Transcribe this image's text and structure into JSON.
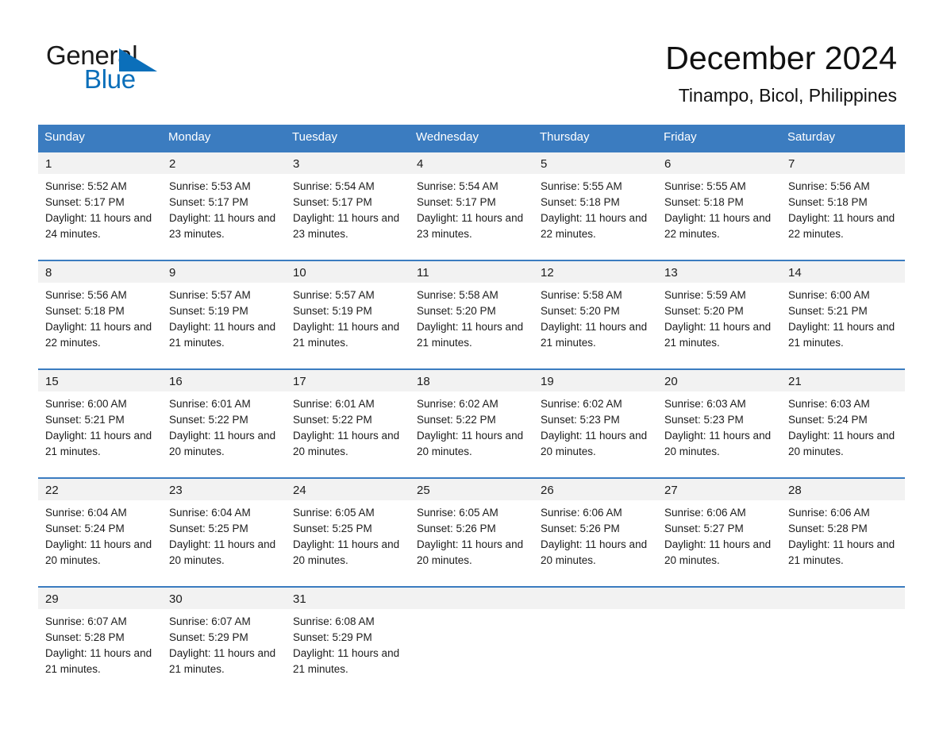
{
  "brand": {
    "name_line1": "General",
    "name_line2": "Blue",
    "triangle_icon": "triangle-logo-icon",
    "accent_color": "#0b6fba"
  },
  "header": {
    "month_title": "December 2024",
    "location": "Tinampo, Bicol, Philippines"
  },
  "colors": {
    "header_blue": "#3b7cc0",
    "daynum_band": "#f2f2f2",
    "text": "#1c1c1c"
  },
  "calendar": {
    "weekdays": [
      "Sunday",
      "Monday",
      "Tuesday",
      "Wednesday",
      "Thursday",
      "Friday",
      "Saturday"
    ],
    "weeks": [
      [
        {
          "day": "1",
          "sunrise": "Sunrise: 5:52 AM",
          "sunset": "Sunset: 5:17 PM",
          "daylight": "Daylight: 11 hours and 24 minutes."
        },
        {
          "day": "2",
          "sunrise": "Sunrise: 5:53 AM",
          "sunset": "Sunset: 5:17 PM",
          "daylight": "Daylight: 11 hours and 23 minutes."
        },
        {
          "day": "3",
          "sunrise": "Sunrise: 5:54 AM",
          "sunset": "Sunset: 5:17 PM",
          "daylight": "Daylight: 11 hours and 23 minutes."
        },
        {
          "day": "4",
          "sunrise": "Sunrise: 5:54 AM",
          "sunset": "Sunset: 5:17 PM",
          "daylight": "Daylight: 11 hours and 23 minutes."
        },
        {
          "day": "5",
          "sunrise": "Sunrise: 5:55 AM",
          "sunset": "Sunset: 5:18 PM",
          "daylight": "Daylight: 11 hours and 22 minutes."
        },
        {
          "day": "6",
          "sunrise": "Sunrise: 5:55 AM",
          "sunset": "Sunset: 5:18 PM",
          "daylight": "Daylight: 11 hours and 22 minutes."
        },
        {
          "day": "7",
          "sunrise": "Sunrise: 5:56 AM",
          "sunset": "Sunset: 5:18 PM",
          "daylight": "Daylight: 11 hours and 22 minutes."
        }
      ],
      [
        {
          "day": "8",
          "sunrise": "Sunrise: 5:56 AM",
          "sunset": "Sunset: 5:18 PM",
          "daylight": "Daylight: 11 hours and 22 minutes."
        },
        {
          "day": "9",
          "sunrise": "Sunrise: 5:57 AM",
          "sunset": "Sunset: 5:19 PM",
          "daylight": "Daylight: 11 hours and 21 minutes."
        },
        {
          "day": "10",
          "sunrise": "Sunrise: 5:57 AM",
          "sunset": "Sunset: 5:19 PM",
          "daylight": "Daylight: 11 hours and 21 minutes."
        },
        {
          "day": "11",
          "sunrise": "Sunrise: 5:58 AM",
          "sunset": "Sunset: 5:20 PM",
          "daylight": "Daylight: 11 hours and 21 minutes."
        },
        {
          "day": "12",
          "sunrise": "Sunrise: 5:58 AM",
          "sunset": "Sunset: 5:20 PM",
          "daylight": "Daylight: 11 hours and 21 minutes."
        },
        {
          "day": "13",
          "sunrise": "Sunrise: 5:59 AM",
          "sunset": "Sunset: 5:20 PM",
          "daylight": "Daylight: 11 hours and 21 minutes."
        },
        {
          "day": "14",
          "sunrise": "Sunrise: 6:00 AM",
          "sunset": "Sunset: 5:21 PM",
          "daylight": "Daylight: 11 hours and 21 minutes."
        }
      ],
      [
        {
          "day": "15",
          "sunrise": "Sunrise: 6:00 AM",
          "sunset": "Sunset: 5:21 PM",
          "daylight": "Daylight: 11 hours and 21 minutes."
        },
        {
          "day": "16",
          "sunrise": "Sunrise: 6:01 AM",
          "sunset": "Sunset: 5:22 PM",
          "daylight": "Daylight: 11 hours and 20 minutes."
        },
        {
          "day": "17",
          "sunrise": "Sunrise: 6:01 AM",
          "sunset": "Sunset: 5:22 PM",
          "daylight": "Daylight: 11 hours and 20 minutes."
        },
        {
          "day": "18",
          "sunrise": "Sunrise: 6:02 AM",
          "sunset": "Sunset: 5:22 PM",
          "daylight": "Daylight: 11 hours and 20 minutes."
        },
        {
          "day": "19",
          "sunrise": "Sunrise: 6:02 AM",
          "sunset": "Sunset: 5:23 PM",
          "daylight": "Daylight: 11 hours and 20 minutes."
        },
        {
          "day": "20",
          "sunrise": "Sunrise: 6:03 AM",
          "sunset": "Sunset: 5:23 PM",
          "daylight": "Daylight: 11 hours and 20 minutes."
        },
        {
          "day": "21",
          "sunrise": "Sunrise: 6:03 AM",
          "sunset": "Sunset: 5:24 PM",
          "daylight": "Daylight: 11 hours and 20 minutes."
        }
      ],
      [
        {
          "day": "22",
          "sunrise": "Sunrise: 6:04 AM",
          "sunset": "Sunset: 5:24 PM",
          "daylight": "Daylight: 11 hours and 20 minutes."
        },
        {
          "day": "23",
          "sunrise": "Sunrise: 6:04 AM",
          "sunset": "Sunset: 5:25 PM",
          "daylight": "Daylight: 11 hours and 20 minutes."
        },
        {
          "day": "24",
          "sunrise": "Sunrise: 6:05 AM",
          "sunset": "Sunset: 5:25 PM",
          "daylight": "Daylight: 11 hours and 20 minutes."
        },
        {
          "day": "25",
          "sunrise": "Sunrise: 6:05 AM",
          "sunset": "Sunset: 5:26 PM",
          "daylight": "Daylight: 11 hours and 20 minutes."
        },
        {
          "day": "26",
          "sunrise": "Sunrise: 6:06 AM",
          "sunset": "Sunset: 5:26 PM",
          "daylight": "Daylight: 11 hours and 20 minutes."
        },
        {
          "day": "27",
          "sunrise": "Sunrise: 6:06 AM",
          "sunset": "Sunset: 5:27 PM",
          "daylight": "Daylight: 11 hours and 20 minutes."
        },
        {
          "day": "28",
          "sunrise": "Sunrise: 6:06 AM",
          "sunset": "Sunset: 5:28 PM",
          "daylight": "Daylight: 11 hours and 21 minutes."
        }
      ],
      [
        {
          "day": "29",
          "sunrise": "Sunrise: 6:07 AM",
          "sunset": "Sunset: 5:28 PM",
          "daylight": "Daylight: 11 hours and 21 minutes."
        },
        {
          "day": "30",
          "sunrise": "Sunrise: 6:07 AM",
          "sunset": "Sunset: 5:29 PM",
          "daylight": "Daylight: 11 hours and 21 minutes."
        },
        {
          "day": "31",
          "sunrise": "Sunrise: 6:08 AM",
          "sunset": "Sunset: 5:29 PM",
          "daylight": "Daylight: 11 hours and 21 minutes."
        },
        {
          "day": "",
          "sunrise": "",
          "sunset": "",
          "daylight": ""
        },
        {
          "day": "",
          "sunrise": "",
          "sunset": "",
          "daylight": ""
        },
        {
          "day": "",
          "sunrise": "",
          "sunset": "",
          "daylight": ""
        },
        {
          "day": "",
          "sunrise": "",
          "sunset": "",
          "daylight": ""
        }
      ]
    ]
  }
}
